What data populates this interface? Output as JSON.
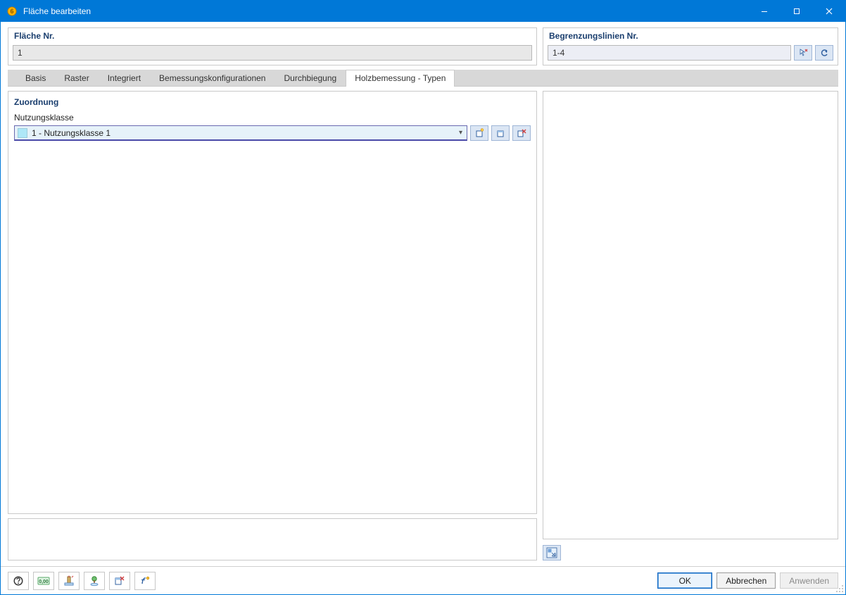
{
  "window": {
    "title": "Fläche bearbeiten"
  },
  "top": {
    "left_header": "Fläche Nr.",
    "left_value": "1",
    "right_header": "Begrenzungslinien Nr.",
    "right_value": "1-4"
  },
  "tabs": [
    {
      "label": "Basis"
    },
    {
      "label": "Raster"
    },
    {
      "label": "Integriert"
    },
    {
      "label": "Bemessungskonfigurationen"
    },
    {
      "label": "Durchbiegung"
    },
    {
      "label": "Holzbemessung - Typen"
    }
  ],
  "active_tab_index": 5,
  "zuordnung": {
    "section_title": "Zuordnung",
    "field_label": "Nutzungsklasse",
    "combo_value": "1 - Nutzungsklasse 1"
  },
  "buttons": {
    "ok": "OK",
    "cancel": "Abbrechen",
    "apply": "Anwenden"
  },
  "icons": {
    "pick": "pick-icon",
    "reverse": "reverse-icon",
    "new_item": "new-item-icon",
    "edit_item": "edit-item-icon",
    "delete_item": "delete-item-icon",
    "view3d": "view-3d-icon",
    "help": "help-icon",
    "units": "units-icon",
    "reference": "reference-icon",
    "tree": "tree-icon",
    "remove_assign": "remove-assign-icon",
    "function": "function-icon"
  }
}
